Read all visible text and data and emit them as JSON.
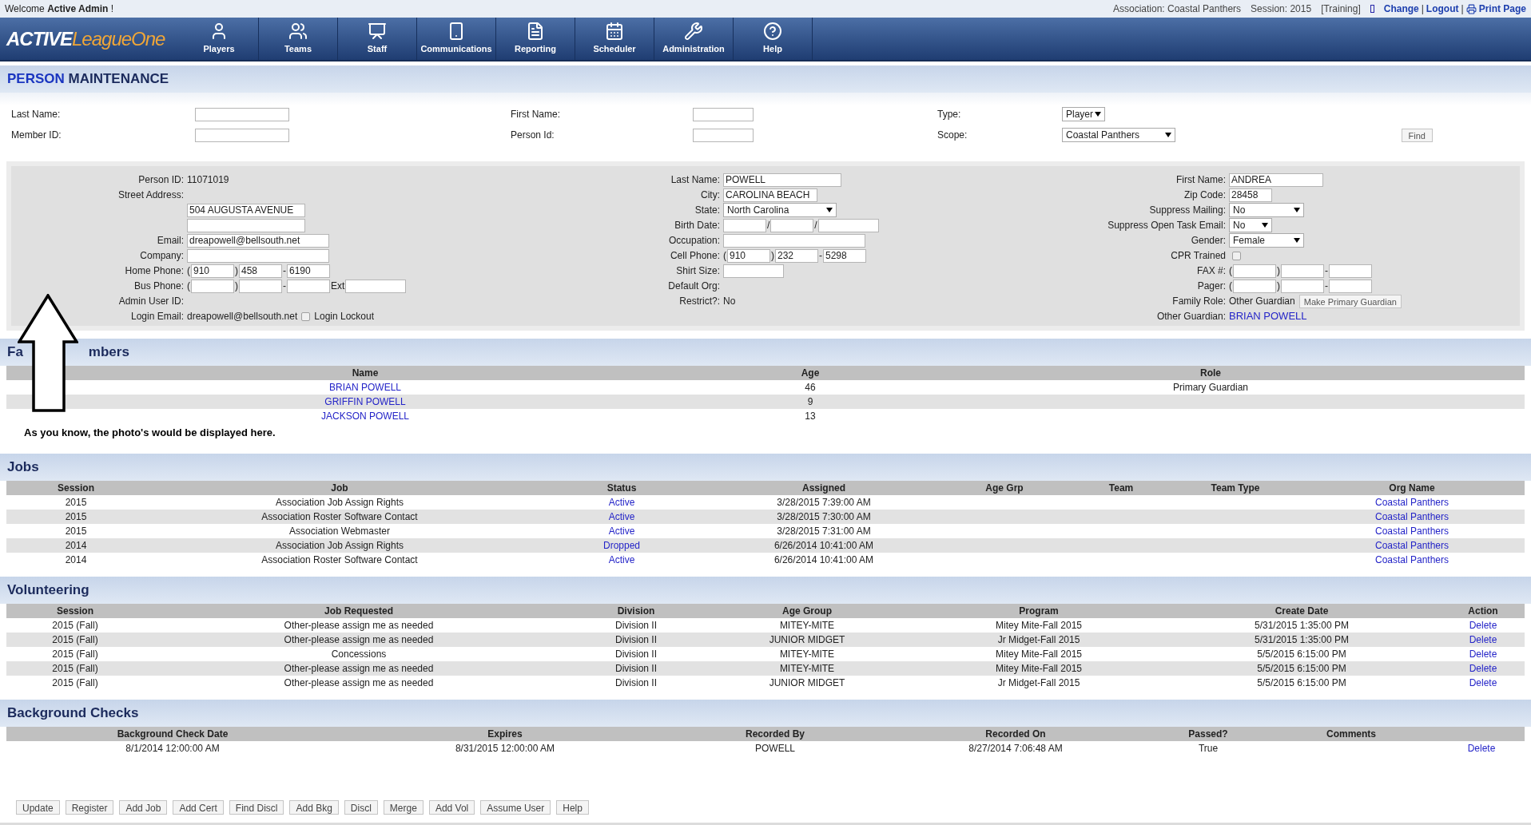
{
  "top_bar": {
    "welcome": "Welcome **Active Admin** !",
    "association": "Association: Coastal Panthers",
    "session": "Session: 2015",
    "mode": "[Training]",
    "links": [
      {
        "kind": "link",
        "text": "Change"
      },
      {
        "kind": "sep",
        "text": "|"
      },
      {
        "kind": "link",
        "text": "Logout"
      },
      {
        "kind": "sep",
        "text": "|"
      },
      {
        "kind": "print",
        "text": "Print Page"
      }
    ]
  },
  "logo": {
    "first": "ACTIVE",
    "second": "LeagueOne"
  },
  "nav": [
    {
      "label": "Players",
      "kind": "user"
    },
    {
      "label": "Teams",
      "kind": "users"
    },
    {
      "label": "Staff",
      "kind": "staff"
    },
    {
      "label": "Communications",
      "kind": "phone"
    },
    {
      "label": "Reporting",
      "kind": "report"
    },
    {
      "label": "Scheduler",
      "kind": "calendar"
    },
    {
      "label": "Administration",
      "kind": "tools"
    },
    {
      "label": "Help",
      "kind": "help"
    }
  ],
  "page_title": [
    "PERSON",
    "MAINTENANCE"
  ],
  "search": {
    "rows": [
      [
        {
          "label": "Last Name:",
          "kind": "input_m"
        },
        {
          "label": "First Name:",
          "kind": "input_s"
        },
        {
          "label": "Type:",
          "kind": "select_s",
          "value": "Player"
        }
      ],
      [
        {
          "label": "Member ID:",
          "kind": "input_m"
        },
        {
          "label": "Person Id:",
          "kind": "input_s"
        },
        {
          "label": "Scope:",
          "kind": "select_l",
          "value": "Coastal Panthers"
        }
      ]
    ],
    "find_button": "Find"
  },
  "details": {
    "columns": [
      {
        "rows": [
          {
            "label": "Person ID:",
            "parts": [
              {
                "kind": "text",
                "text": "11071019"
              }
            ]
          },
          {
            "label": "Street Address:",
            "parts": []
          },
          {
            "parts": [
              {
                "kind": "input_l",
                "value": "504 AUGUSTA AVENUE"
              }
            ]
          },
          {
            "parts": [
              {
                "kind": "input_l"
              }
            ]
          },
          {
            "label": "Email:",
            "parts": [
              {
                "kind": "input_xl",
                "value": "dreapowell@bellsouth.net"
              }
            ]
          },
          {
            "label": "Company:",
            "parts": [
              {
                "kind": "input_xl"
              }
            ]
          },
          {
            "label": "Home Phone:",
            "parts": [
              {
                "kind": "text",
                "text": "("
              },
              {
                "kind": "input_xs",
                "value": "910"
              },
              {
                "kind": "text",
                "text": ")"
              },
              {
                "kind": "input_xs",
                "value": "458"
              },
              {
                "kind": "text",
                "text": "-"
              },
              {
                "kind": "input_xs",
                "value": "6190"
              }
            ]
          },
          {
            "label": "Bus Phone:",
            "parts": [
              {
                "kind": "text",
                "text": "("
              },
              {
                "kind": "input_xs"
              },
              {
                "kind": "text",
                "text": ")"
              },
              {
                "kind": "input_xs"
              },
              {
                "kind": "text",
                "text": "-"
              },
              {
                "kind": "input_xs"
              },
              {
                "kind": "text",
                "text": "Ext"
              },
              {
                "kind": "input_s"
              }
            ]
          },
          {
            "label": "Admin User ID:",
            "parts": []
          },
          {
            "label": "Login Email:",
            "parts": [
              {
                "kind": "text",
                "text": "dreapowell@bellsouth.net"
              },
              {
                "kind": "checkbox",
                "checked": false
              },
              {
                "kind": "text",
                "text": "Login Lockout"
              }
            ]
          }
        ]
      },
      {
        "rows": [
          {
            "label": "Last Name:",
            "parts": [
              {
                "kind": "input_l",
                "value": "POWELL"
              }
            ]
          },
          {
            "label": "City:",
            "parts": [
              {
                "kind": "input_m",
                "value": "CAROLINA BEACH"
              }
            ]
          },
          {
            "label": "State:",
            "parts": [
              {
                "kind": "select_l",
                "value": "North Carolina"
              }
            ]
          },
          {
            "label": "Birth Date:",
            "parts": [
              {
                "kind": "input_xs"
              },
              {
                "kind": "text",
                "text": "/"
              },
              {
                "kind": "input_xs"
              },
              {
                "kind": "text",
                "text": "/"
              },
              {
                "kind": "input_s"
              }
            ]
          },
          {
            "label": "Occupation:",
            "parts": [
              {
                "kind": "input_xl"
              }
            ]
          },
          {
            "label": "Cell Phone:",
            "parts": [
              {
                "kind": "text",
                "text": "("
              },
              {
                "kind": "input_xs",
                "value": "910"
              },
              {
                "kind": "text",
                "text": ")"
              },
              {
                "kind": "input_xs",
                "value": "232"
              },
              {
                "kind": "text",
                "text": "-"
              },
              {
                "kind": "input_xs",
                "value": "5298"
              }
            ]
          },
          {
            "label": "Shirt Size:",
            "parts": [
              {
                "kind": "input_s"
              }
            ]
          },
          {
            "label": "Default Org:",
            "parts": []
          },
          {
            "label": "Restrict?:",
            "parts": [
              {
                "kind": "text",
                "text": "No"
              }
            ]
          }
        ]
      },
      {
        "rows": [
          {
            "label": "First Name:",
            "parts": [
              {
                "kind": "input_m",
                "value": "ANDREA"
              }
            ]
          },
          {
            "label": "Zip Code:",
            "parts": [
              {
                "kind": "input_xs",
                "value": "28458"
              }
            ]
          },
          {
            "label": "Suppress Mailing:",
            "parts": [
              {
                "kind": "select_m",
                "value": "No"
              }
            ]
          },
          {
            "label": "Suppress Open Task Email:",
            "parts": [
              {
                "kind": "select_s",
                "value": "No"
              }
            ]
          },
          {
            "label": "Gender:",
            "parts": [
              {
                "kind": "select_m",
                "value": "Female"
              }
            ]
          },
          {
            "label": "CPR Trained",
            "parts": [
              {
                "kind": "checkbox",
                "checked": false
              }
            ]
          },
          {
            "label": "FAX #:",
            "parts": [
              {
                "kind": "text",
                "text": "("
              },
              {
                "kind": "input_xs"
              },
              {
                "kind": "text",
                "text": ")"
              },
              {
                "kind": "input_xs"
              },
              {
                "kind": "text",
                "text": "-"
              },
              {
                "kind": "input_xs"
              }
            ]
          },
          {
            "label": "Pager:",
            "parts": [
              {
                "kind": "text",
                "text": "("
              },
              {
                "kind": "input_xs"
              },
              {
                "kind": "text",
                "text": ")"
              },
              {
                "kind": "input_xs"
              },
              {
                "kind": "text",
                "text": "-"
              },
              {
                "kind": "input_xs"
              }
            ]
          },
          {
            "label": "Family Role:",
            "parts": [
              {
                "kind": "text",
                "text": "Other Guardian"
              },
              {
                "kind": "button",
                "text": "Make Primary Guardian"
              }
            ]
          },
          {
            "label": "Other Guardian:",
            "parts": [
              {
                "kind": "link",
                "text": "BRIAN POWELL"
              }
            ]
          }
        ]
      }
    ]
  },
  "family": {
    "title_parts": [
      "Fa",
      "mbers"
    ],
    "note": "As you know, the photo's would be displayed here.",
    "columns": [
      {
        "label": "Name",
        "kind": "link"
      },
      {
        "label": "Age",
        "kind": "text"
      },
      {
        "label": "Role",
        "kind": "text"
      }
    ],
    "rows": [
      [
        "BRIAN POWELL",
        "46",
        "Primary Guardian"
      ],
      [
        "GRIFFIN POWELL",
        "9",
        null
      ],
      [
        "JACKSON POWELL",
        "13",
        null
      ]
    ]
  },
  "jobs": {
    "title": "Jobs",
    "columns": [
      {
        "label": "Session"
      },
      {
        "label": "Job"
      },
      {
        "label": "Status",
        "kind": "link"
      },
      {
        "label": "Assigned"
      },
      {
        "label": "Age Grp"
      },
      {
        "label": "Team"
      },
      {
        "label": "Team Type"
      },
      {
        "label": "Org Name",
        "kind": "link"
      }
    ],
    "rows": [
      [
        "2015",
        "Association Job Assign Rights",
        "Active",
        "3/28/2015 7:39:00 AM",
        null,
        null,
        null,
        "Coastal Panthers"
      ],
      [
        "2015",
        "Association Roster Software Contact",
        "Active",
        "3/28/2015 7:30:00 AM",
        null,
        null,
        null,
        "Coastal Panthers"
      ],
      [
        "2015",
        "Association Webmaster",
        "Active",
        "3/28/2015 7:31:00 AM",
        null,
        null,
        null,
        "Coastal Panthers"
      ],
      [
        "2014",
        "Association Job Assign Rights",
        "Dropped",
        "6/26/2014 10:41:00 AM",
        null,
        null,
        null,
        "Coastal Panthers"
      ],
      [
        "2014",
        "Association Roster Software Contact",
        "Active",
        "6/26/2014 10:41:00 AM",
        null,
        null,
        null,
        "Coastal Panthers"
      ]
    ]
  },
  "volunteering": {
    "title": "Volunteering",
    "columns": [
      {
        "label": "Session",
        "kind": "text"
      },
      {
        "label": "Job Requested",
        "kind": "text"
      },
      {
        "label": "Division",
        "kind": "text"
      },
      {
        "label": "Age Group",
        "kind": "text"
      },
      {
        "label": "Program",
        "kind": "text"
      },
      {
        "label": "Create Date",
        "kind": "text"
      },
      {
        "label": "Action",
        "kind": "link"
      }
    ],
    "rows": [
      [
        "2015 (Fall)",
        "Other-please assign me as needed",
        "Division II",
        "MITEY-MITE",
        "Mitey Mite-Fall 2015",
        "5/31/2015 1:35:00 PM",
        "Delete"
      ],
      [
        "2015 (Fall)",
        "Other-please assign me as needed",
        "Division II",
        "JUNIOR MIDGET",
        "Jr Midget-Fall 2015",
        "5/31/2015 1:35:00 PM",
        "Delete"
      ],
      [
        "2015 (Fall)",
        "Concessions",
        "Division II",
        "MITEY-MITE",
        "Mitey Mite-Fall 2015",
        "5/5/2015 6:15:00 PM",
        "Delete"
      ],
      [
        "2015 (Fall)",
        "Other-please assign me as needed",
        "Division II",
        "MITEY-MITE",
        "Mitey Mite-Fall 2015",
        "5/5/2015 6:15:00 PM",
        "Delete"
      ],
      [
        "2015 (Fall)",
        "Other-please assign me as needed",
        "Division II",
        "JUNIOR MIDGET",
        "Jr Midget-Fall 2015",
        "5/5/2015 6:15:00 PM",
        "Delete"
      ]
    ]
  },
  "background_checks": {
    "title": "Background Checks",
    "columns": [
      {
        "label": "Background Check Date"
      },
      {
        "label": "Expires"
      },
      {
        "label": "Recorded By"
      },
      {
        "label": "Recorded On"
      },
      {
        "label": "Passed?"
      },
      {
        "label": "Comments"
      },
      {
        "kind": "link"
      }
    ],
    "rows": [
      [
        "8/1/2014 12:00:00 AM",
        "8/31/2015 12:00:00 AM",
        "POWELL",
        "8/27/2014 7:06:48 AM",
        "True",
        null,
        "Delete"
      ]
    ]
  },
  "buttons": [
    "Update",
    "Register",
    "Add Job",
    "Add Cert",
    "Find Discl",
    "Add Bkg",
    "Discl",
    "Merge",
    "Add Vol",
    "Assume User",
    "Help"
  ]
}
